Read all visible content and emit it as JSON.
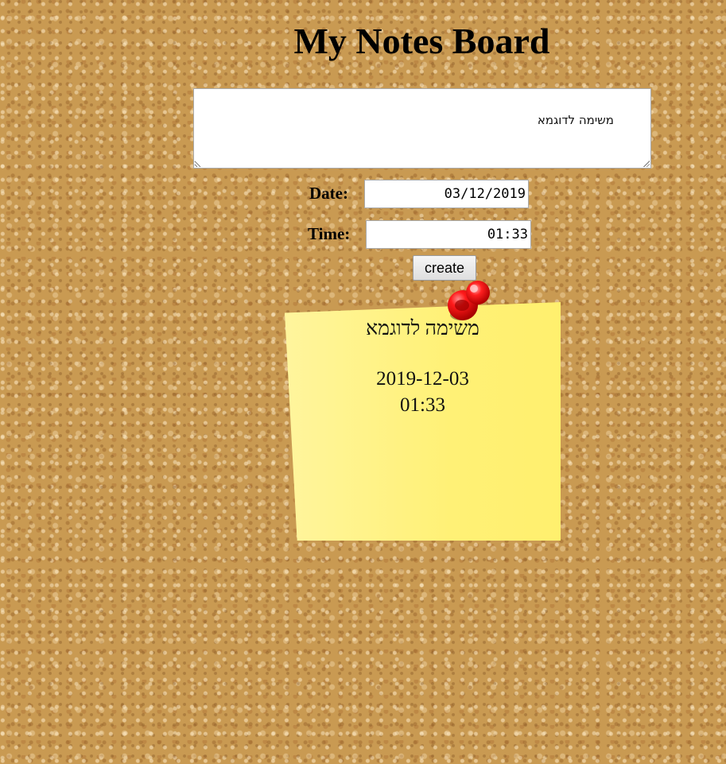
{
  "page": {
    "title": "My Notes Board"
  },
  "form": {
    "note_text": "משימה לדוגמא",
    "date_label": "Date:",
    "date_value": "03/12/2019",
    "time_label": "Time:",
    "time_value": "01:33",
    "create_label": "create"
  },
  "notes": [
    {
      "text": "משימה לדוגמא",
      "date": "2019-12-03",
      "time": "01:33",
      "pin_icon": "push-pin-icon"
    }
  ],
  "colors": {
    "cork_background": "#c99a52",
    "note_yellow_light": "#fff59d",
    "note_yellow": "#fff176",
    "pin_red": "#e00000"
  }
}
